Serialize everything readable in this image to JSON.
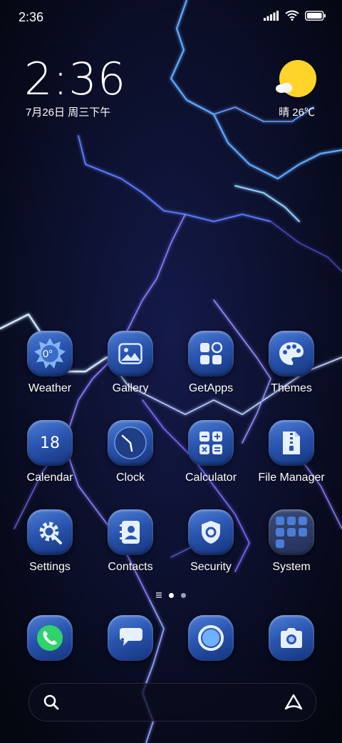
{
  "status_bar": {
    "time": "2:36",
    "icons": [
      "signal-icon",
      "wifi-icon",
      "battery-icon"
    ]
  },
  "clock_widget": {
    "time": "2:36",
    "date": "7月26日 周三下午"
  },
  "weather_widget": {
    "condition_temp": "晴 26℃",
    "icon": "sun-cloud-icon"
  },
  "apps": [
    {
      "label": "Weather",
      "icon": "weather-sun-icon",
      "icon_text": "0°"
    },
    {
      "label": "Gallery",
      "icon": "gallery-icon"
    },
    {
      "label": "GetApps",
      "icon": "getapps-icon"
    },
    {
      "label": "Themes",
      "icon": "palette-icon"
    },
    {
      "label": "Calendar",
      "icon": "calendar-icon",
      "icon_text": "18"
    },
    {
      "label": "Clock",
      "icon": "clock-icon"
    },
    {
      "label": "Calculator",
      "icon": "calculator-icon"
    },
    {
      "label": "File Manager",
      "icon": "file-zip-icon"
    },
    {
      "label": "Settings",
      "icon": "gear-icon"
    },
    {
      "label": "Contacts",
      "icon": "contacts-icon"
    },
    {
      "label": "Security",
      "icon": "shield-icon"
    },
    {
      "label": "System",
      "icon": "folder-grid-icon"
    }
  ],
  "page_indicator": {
    "pages": 2,
    "active": 1
  },
  "dock": [
    {
      "icon": "phone-icon"
    },
    {
      "icon": "messages-icon"
    },
    {
      "icon": "browser-icon"
    },
    {
      "icon": "camera-icon"
    }
  ],
  "search_bar": {
    "search_icon": "search-icon",
    "assistant_icon": "assistant-icon"
  },
  "colors": {
    "tile_blue": "#2a55b0",
    "sun_yellow": "#ffd42a",
    "lightning": "#7fb8ff",
    "background": "#070a1e"
  }
}
